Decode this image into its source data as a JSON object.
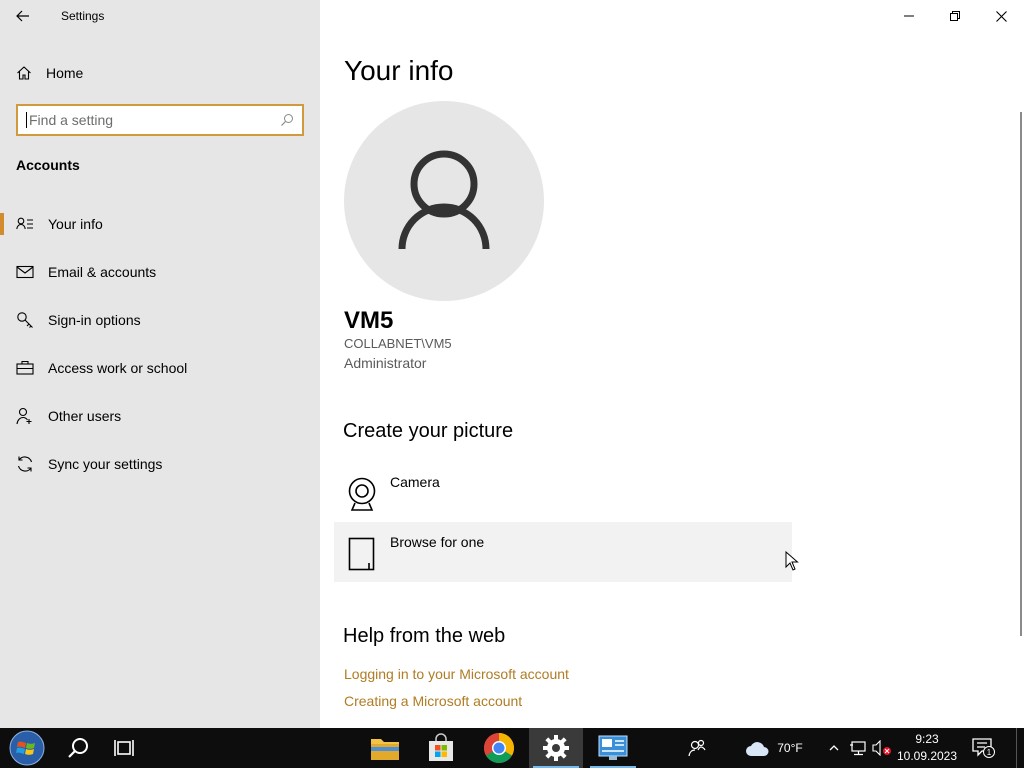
{
  "window": {
    "title": "Settings"
  },
  "sidebar": {
    "home_label": "Home",
    "search_placeholder": "Find a setting",
    "search_value": "",
    "section_title": "Accounts",
    "items": [
      {
        "label": "Your info",
        "icon": "person-list-icon",
        "active": true
      },
      {
        "label": "Email & accounts",
        "icon": "mail-icon",
        "active": false
      },
      {
        "label": "Sign-in options",
        "icon": "key-icon",
        "active": false
      },
      {
        "label": "Access work or school",
        "icon": "briefcase-icon",
        "active": false
      },
      {
        "label": "Other users",
        "icon": "person-add-icon",
        "active": false
      },
      {
        "label": "Sync your settings",
        "icon": "sync-icon",
        "active": false
      }
    ]
  },
  "main": {
    "page_title": "Your info",
    "user": {
      "name": "VM5",
      "domain": "COLLABNET\\VM5",
      "role": "Administrator"
    },
    "create_picture": {
      "title": "Create your picture",
      "options": [
        {
          "label": "Camera",
          "icon": "camera-icon"
        },
        {
          "label": "Browse for one",
          "icon": "file-icon"
        }
      ]
    },
    "help": {
      "title": "Help from the web",
      "links": [
        "Logging in to your Microsoft account",
        "Creating a Microsoft account"
      ]
    }
  },
  "taskbar": {
    "weather_temp": "70°F",
    "time": "9:23",
    "date": "10.09.2023",
    "notification_count": "1",
    "colors": {
      "background": "#0d0d0d",
      "accent": "#d48b2f",
      "link": "#b07c24"
    }
  }
}
